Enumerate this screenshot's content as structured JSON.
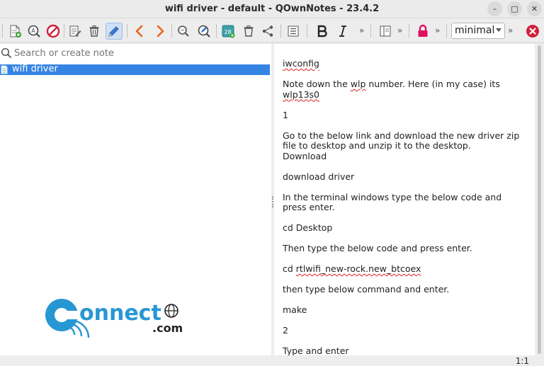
{
  "window": {
    "title": "wifi driver - default - QOwnNotes - 23.4.2",
    "minimize": "–",
    "maximize": "□",
    "close": "✕"
  },
  "toolbar": {
    "more_glyph": "»",
    "mode_value": "minimal"
  },
  "search": {
    "placeholder": "Search or create note",
    "value": ""
  },
  "notes": [
    {
      "label": "wifi driver",
      "selected": true
    }
  ],
  "editor": {
    "lines": [
      {
        "text": "iwconfig",
        "spell": true
      },
      {
        "parts": [
          {
            "t": "Note down the "
          },
          {
            "t": "wlp",
            "s": true
          },
          {
            "t": " number. Here (in my case) its "
          },
          {
            "t": "wlp13s0",
            "s": true
          }
        ]
      },
      {
        "text": "1"
      },
      {
        "text": "Go to the below link and download the new driver zip file to desktop and unzip it to the desktop.\nDownload"
      },
      {
        "text": "download driver"
      },
      {
        "text": "In the terminal windows type the below code and press enter."
      },
      {
        "text": "cd Desktop"
      },
      {
        "text": "Then type the below code and press enter."
      },
      {
        "parts": [
          {
            "t": "cd "
          },
          {
            "t": "rtlwifi_new-rock.new_btcoex",
            "s": true
          }
        ]
      },
      {
        "text": "then type below command and enter."
      },
      {
        "text": "make"
      },
      {
        "text": "2"
      },
      {
        "text": "Type and enter"
      }
    ]
  },
  "watermark": {
    "text": "connect.com"
  },
  "status": {
    "cursor": "1:1"
  },
  "colors": {
    "selection": "#3584e4",
    "danger": "#d0213a",
    "lock": "#e0115f",
    "logo_blue": "#2797d4"
  }
}
